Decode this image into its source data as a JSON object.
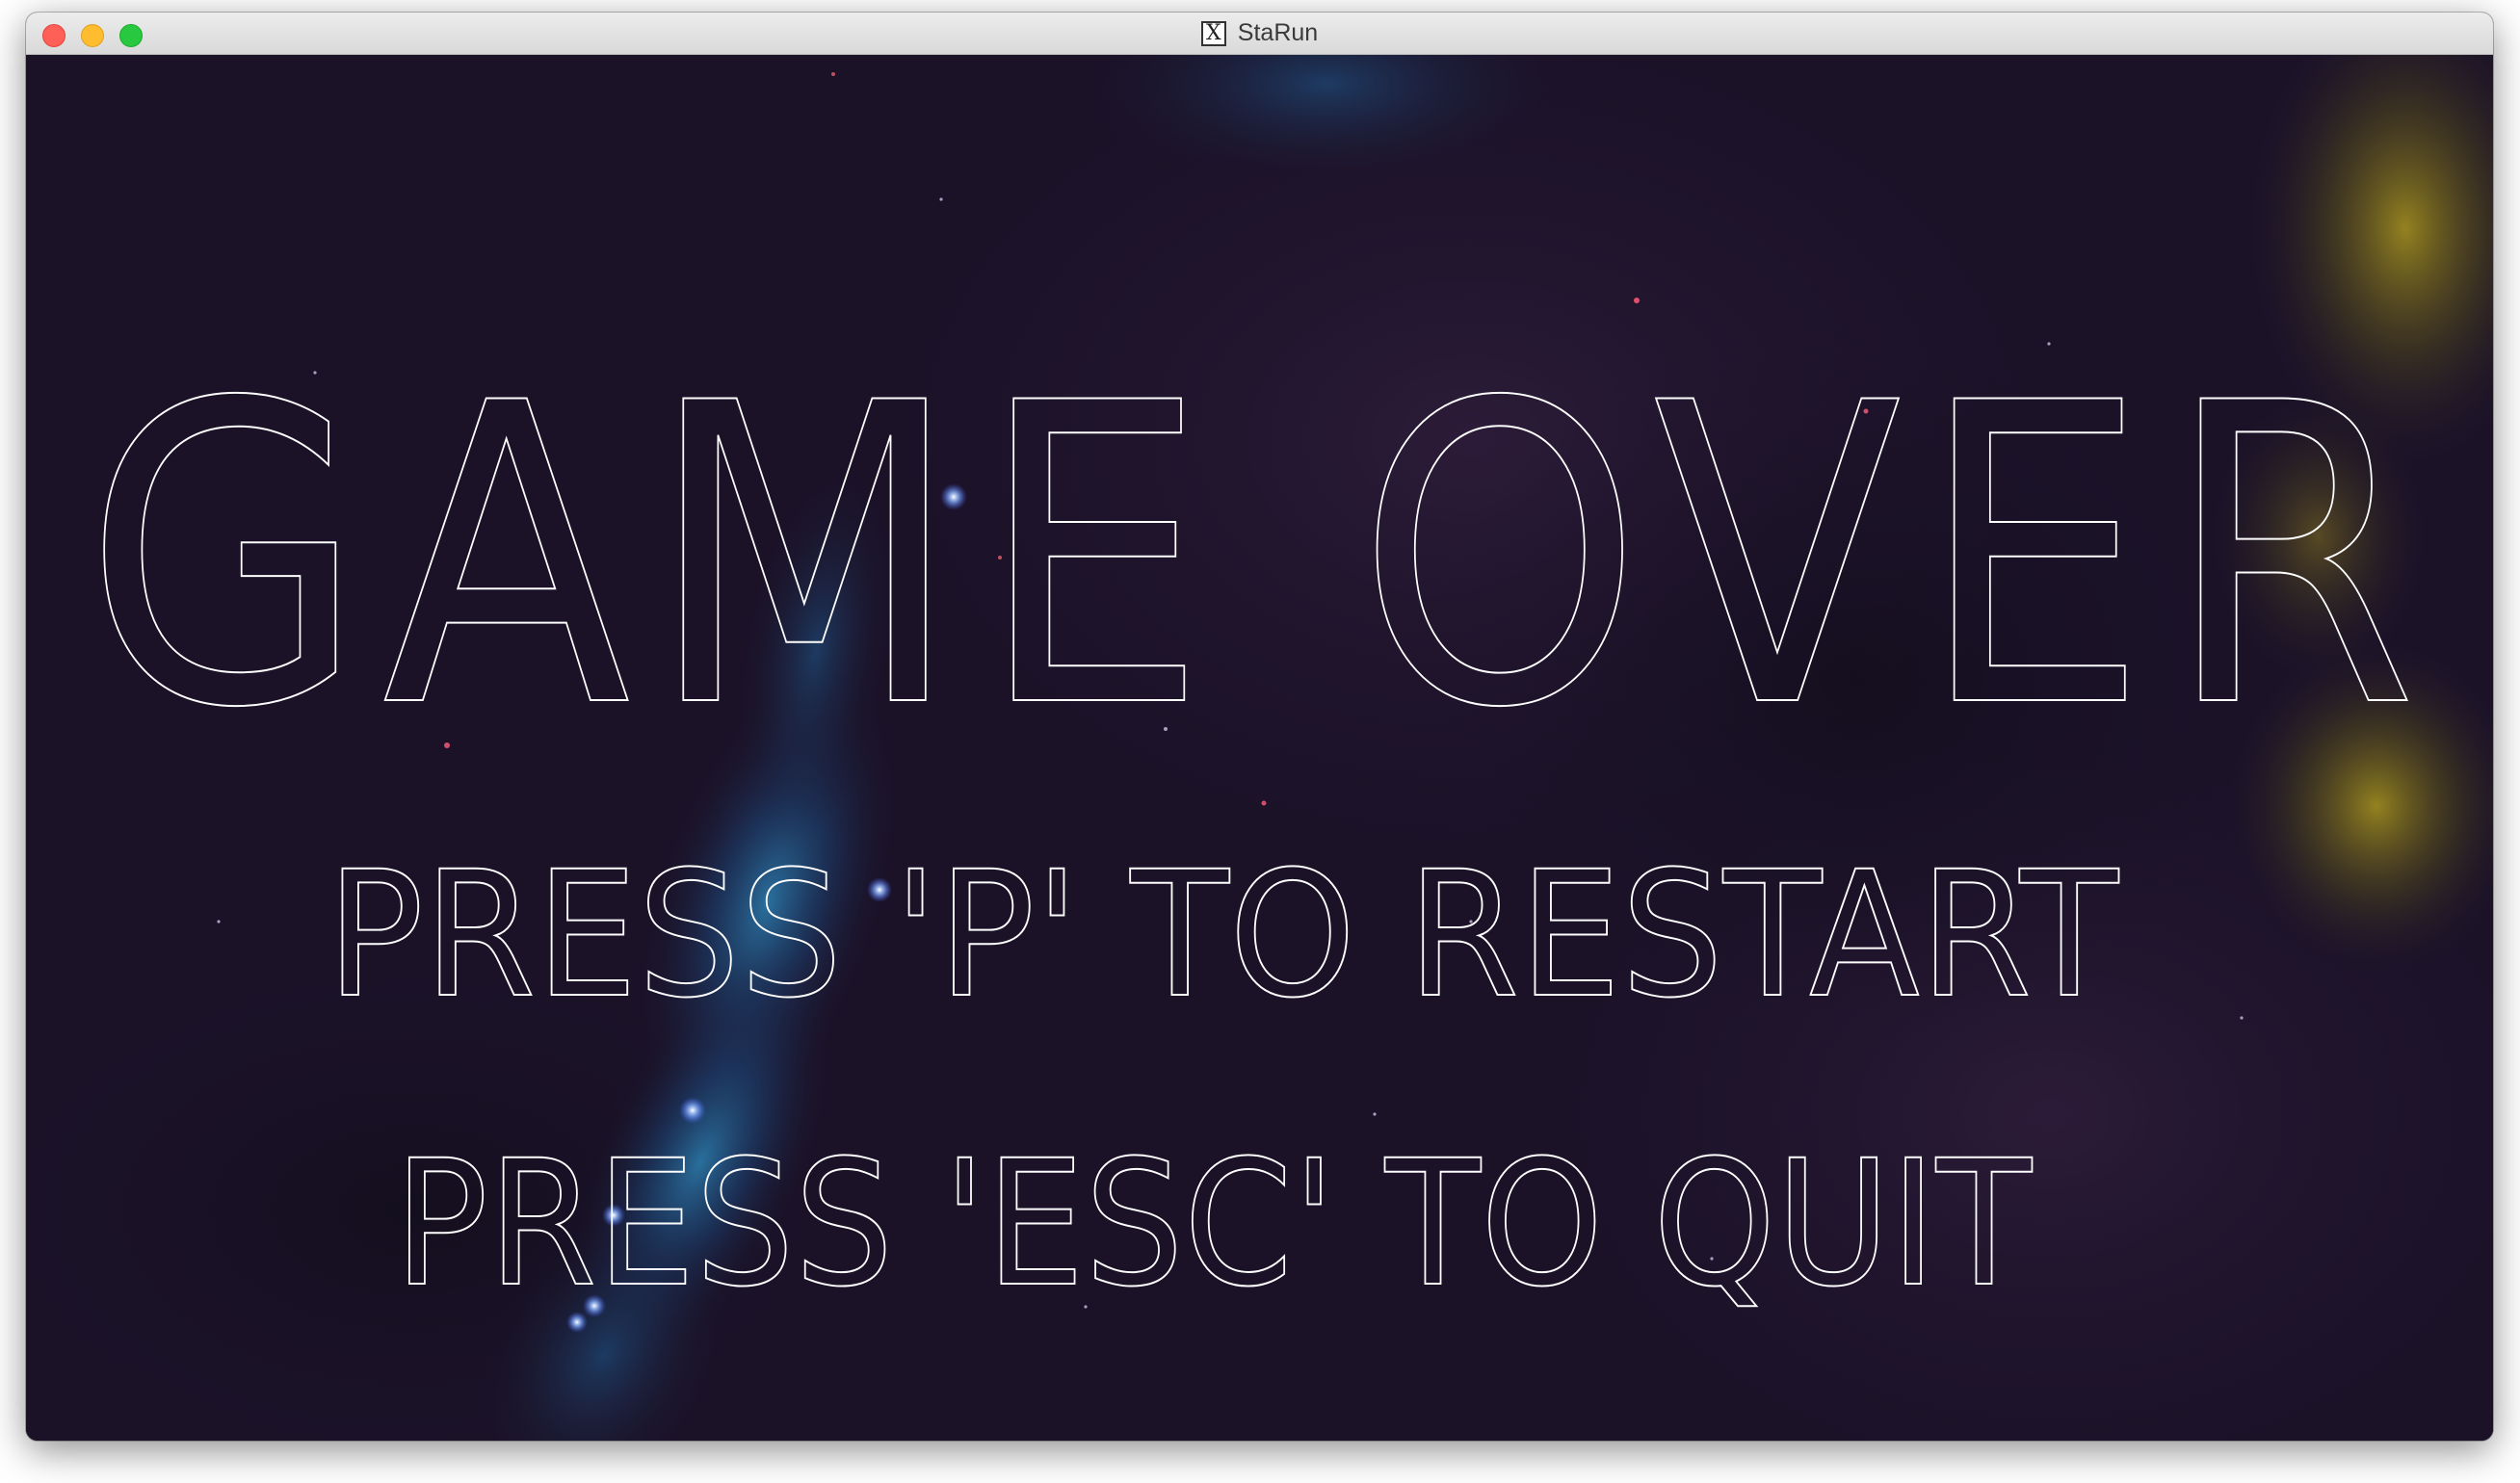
{
  "window": {
    "title": "StaRun",
    "title_icon": "x11-icon",
    "title_icon_glyph": "X"
  },
  "game": {
    "screen": "game-over",
    "headline": "GAME OVER",
    "restart_prompt": "PRESS 'P' TO RESTART",
    "quit_prompt": "PRESS 'ESC' TO QUIT",
    "text_color": "#ffffff",
    "background_color": "#1b1228",
    "nebula_blue": "#2a6fa8",
    "nebula_yellow": "#b8a418"
  }
}
